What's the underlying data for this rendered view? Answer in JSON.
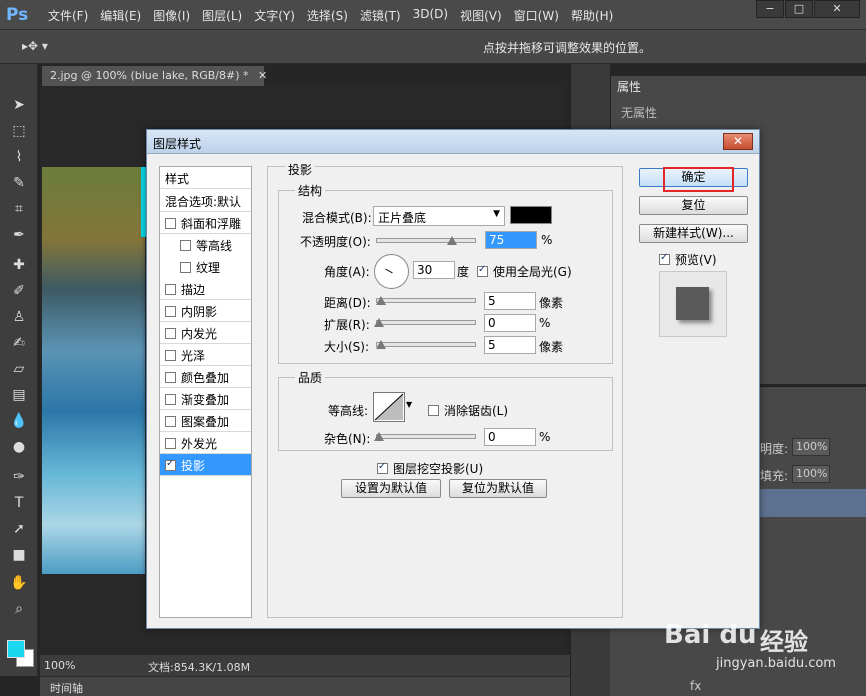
{
  "app": {
    "logo": "Ps"
  },
  "menu": [
    "文件(F)",
    "编辑(E)",
    "图像(I)",
    "图层(L)",
    "文字(Y)",
    "选择(S)",
    "滤镜(T)",
    "3D(D)",
    "视图(V)",
    "窗口(W)",
    "帮助(H)"
  ],
  "window_controls": {
    "minimize": "−",
    "restore": "□",
    "close": "✕"
  },
  "options_bar": {
    "hint": "点按并拖移可调整效果的位置。"
  },
  "document": {
    "tab_title": "2.jpg @ 100% (blue  lake, RGB/8#) *",
    "tab_close": "✕"
  },
  "status": {
    "zoom": "100%",
    "doc_info": "文档:854.3K/1.08M",
    "timeline": "时间轴"
  },
  "properties_panel": {
    "tab": "属性",
    "empty_text": "无属性"
  },
  "layers_panel": {
    "opacity_label": "明度:",
    "opacity_value": "100%",
    "fill_label": "填充:",
    "fill_value": "100%",
    "icons_label": "fx"
  },
  "dialog": {
    "title": "图层样式",
    "close": "✕",
    "styles_header": "样式",
    "style_items": [
      {
        "label": "混合选项:默认",
        "has_checkbox": false,
        "checked": false,
        "sub": false
      },
      {
        "label": "斜面和浮雕",
        "has_checkbox": true,
        "checked": false,
        "sub": false
      },
      {
        "label": "等高线",
        "has_checkbox": true,
        "checked": false,
        "sub": true
      },
      {
        "label": "纹理",
        "has_checkbox": true,
        "checked": false,
        "sub": true
      },
      {
        "label": "描边",
        "has_checkbox": true,
        "checked": false,
        "sub": false
      },
      {
        "label": "内阴影",
        "has_checkbox": true,
        "checked": false,
        "sub": false
      },
      {
        "label": "内发光",
        "has_checkbox": true,
        "checked": false,
        "sub": false
      },
      {
        "label": "光泽",
        "has_checkbox": true,
        "checked": false,
        "sub": false
      },
      {
        "label": "颜色叠加",
        "has_checkbox": true,
        "checked": false,
        "sub": false
      },
      {
        "label": "渐变叠加",
        "has_checkbox": true,
        "checked": false,
        "sub": false
      },
      {
        "label": "图案叠加",
        "has_checkbox": true,
        "checked": false,
        "sub": false
      },
      {
        "label": "外发光",
        "has_checkbox": true,
        "checked": false,
        "sub": false
      },
      {
        "label": "投影",
        "has_checkbox": true,
        "checked": true,
        "sub": false,
        "selected": true
      }
    ],
    "section_title": "投影",
    "structure": {
      "title": "结构",
      "blend_mode_label": "混合模式(B):",
      "blend_mode_value": "正片叠底",
      "shadow_color": "#000000",
      "opacity_label": "不透明度(O):",
      "opacity_value": "75",
      "opacity_fraction": 0.75,
      "angle_label": "角度(A):",
      "angle_value": "30",
      "angle_unit": "度",
      "global_light_label": "使用全局光(G)",
      "global_light_checked": true,
      "distance_label": "距离(D):",
      "distance_value": "5",
      "distance_unit": "像素",
      "spread_label": "扩展(R):",
      "spread_value": "0",
      "size_label": "大小(S):",
      "size_value": "5",
      "size_unit": "像素",
      "percent": "%"
    },
    "quality": {
      "title": "品质",
      "contour_label": "等高线:",
      "antialias_label": "消除锯齿(L)",
      "antialias_checked": false,
      "noise_label": "杂色(N):",
      "noise_value": "0",
      "percent": "%"
    },
    "knockout_label": "图层挖空投影(U)",
    "knockout_checked": true,
    "make_default": "设置为默认值",
    "reset_default": "复位为默认值",
    "ok": "确定",
    "reset": "复位",
    "new_style": "新建样式(W)...",
    "preview_label": "预览(V)",
    "preview_checked": true
  },
  "watermark": {
    "logo": "Bai du",
    "brand": "经验",
    "url": "jingyan.baidu.com"
  }
}
